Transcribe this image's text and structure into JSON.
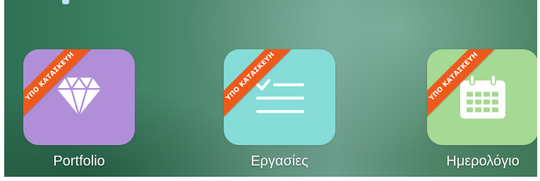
{
  "colors": {
    "portfolio_tile": "#b18fd8",
    "tasks_tile": "#86dcd7",
    "calendar_tile": "#a6d993",
    "ribbon": "#ee5a1c"
  },
  "apps": [
    {
      "label": "Portfolio",
      "badge": "ΥΠΟ ΚΑΤΑΣΚΕΥΗ",
      "icon": "diamond-icon"
    },
    {
      "label": "Εργασίες",
      "badge": "ΥΠΟ ΚΑΤΑΣΚΕΥΗ",
      "icon": "checklist-icon"
    },
    {
      "label": "Ημερολόγιο",
      "badge": "ΥΠΟ ΚΑΤΑΣΚΕΥΗ",
      "icon": "calendar-icon"
    }
  ]
}
